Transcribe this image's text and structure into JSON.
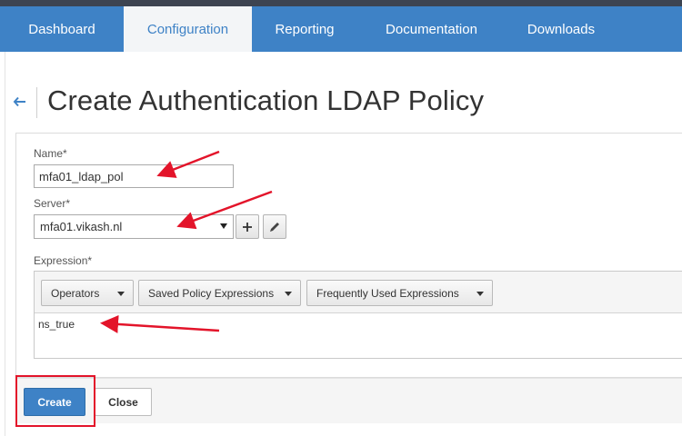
{
  "nav": {
    "tabs": [
      {
        "label": "Dashboard",
        "active": false
      },
      {
        "label": "Configuration",
        "active": true
      },
      {
        "label": "Reporting",
        "active": false
      },
      {
        "label": "Documentation",
        "active": false
      },
      {
        "label": "Downloads",
        "active": false
      }
    ]
  },
  "page": {
    "title": "Create Authentication LDAP Policy",
    "back_icon": "back-arrow-icon"
  },
  "form": {
    "name_label": "Name*",
    "name_value": "mfa01_ldap_pol",
    "server_label": "Server*",
    "server_value": "mfa01.vikash.nl",
    "add_icon": "plus-icon",
    "edit_icon": "pencil-icon",
    "expression_label": "Expression*",
    "expression_buttons": [
      "Operators",
      "Saved Policy Expressions",
      "Frequently Used Expressions"
    ],
    "expression_value": "ns_true"
  },
  "actions": {
    "create_label": "Create",
    "close_label": "Close"
  },
  "colors": {
    "nav_bg": "#3e82c6",
    "primary_button": "#3e82c6",
    "annotation_red": "#e3142a"
  }
}
